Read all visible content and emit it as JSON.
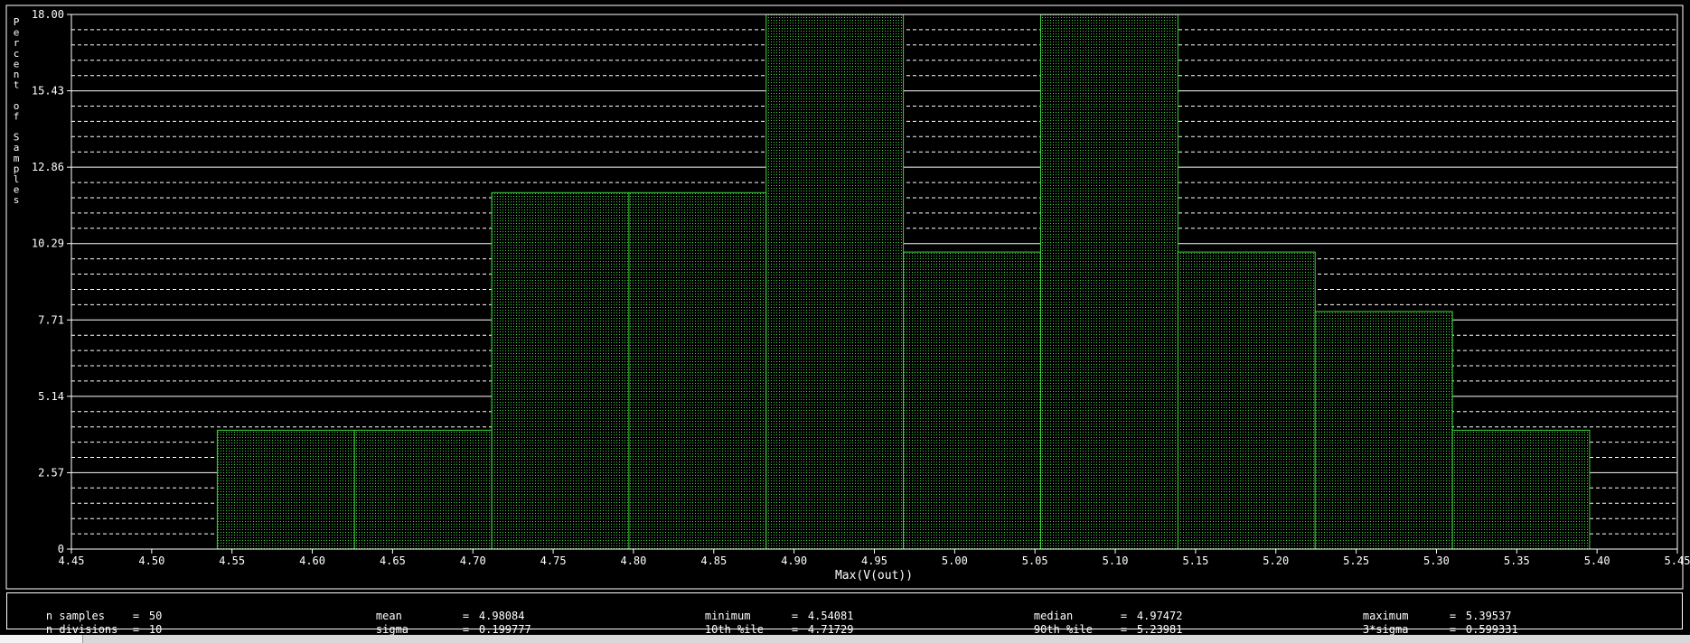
{
  "chart_data": {
    "type": "bar",
    "histogram": true,
    "y_label_stacked": "Percent of Samples",
    "xlabel": "Max(V(out))",
    "xlim": [
      4.45,
      5.45
    ],
    "ylim": [
      0,
      18
    ],
    "x_ticks": [
      "4.45",
      "4.50",
      "4.55",
      "4.60",
      "4.65",
      "4.70",
      "4.75",
      "4.80",
      "4.85",
      "4.90",
      "4.95",
      "5.00",
      "5.05",
      "5.10",
      "5.15",
      "5.20",
      "5.25",
      "5.30",
      "5.35",
      "5.40",
      "5.45"
    ],
    "y_ticks": [
      "0",
      "2.57",
      "5.14",
      "7.71",
      "10.29",
      "12.86",
      "15.43",
      "18.00"
    ],
    "grid": "horizontal, solid at labeled ticks and dashed minor lines",
    "bins": [
      {
        "from": 4.54081,
        "to": 4.62627,
        "value": 4
      },
      {
        "from": 4.62627,
        "to": 4.71172,
        "value": 4
      },
      {
        "from": 4.71172,
        "to": 4.79718,
        "value": 12
      },
      {
        "from": 4.79718,
        "to": 4.88264,
        "value": 12
      },
      {
        "from": 4.88264,
        "to": 4.96809,
        "value": 18
      },
      {
        "from": 4.96809,
        "to": 5.05355,
        "value": 10
      },
      {
        "from": 5.05355,
        "to": 5.13901,
        "value": 18
      },
      {
        "from": 5.13901,
        "to": 5.22446,
        "value": 10
      },
      {
        "from": 5.22446,
        "to": 5.30992,
        "value": 8
      },
      {
        "from": 5.30992,
        "to": 5.39537,
        "value": 4
      }
    ],
    "colors": {
      "background": "#000000",
      "bars": "#3bd63b",
      "grid": "#ffffff",
      "text": "#ffffff"
    }
  },
  "stats": [
    {
      "key": "n samples",
      "value": "50"
    },
    {
      "key": "n divisions",
      "value": "10"
    },
    {
      "key": "mean",
      "value": "4.98084"
    },
    {
      "key": "sigma",
      "value": "0.199777"
    },
    {
      "key": "minimum",
      "value": "4.54081"
    },
    {
      "key": "10th %ile",
      "value": "4.71729"
    },
    {
      "key": "median",
      "value": "4.97472"
    },
    {
      "key": "90th %ile",
      "value": "5.23981"
    },
    {
      "key": "maximum",
      "value": "5.39537"
    },
    {
      "key": "3*sigma",
      "value": "0.599331"
    }
  ]
}
